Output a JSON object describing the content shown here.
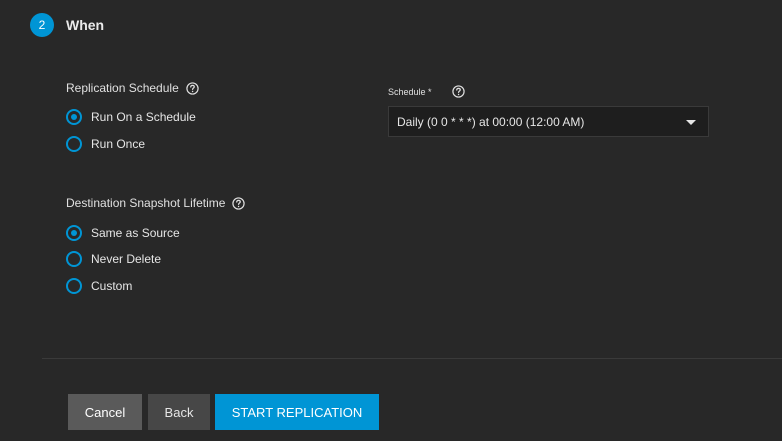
{
  "step": {
    "number": "2",
    "title": "When"
  },
  "replication_schedule": {
    "label": "Replication Schedule",
    "help_icon": "help-circle-icon",
    "options": [
      {
        "label": "Run On a Schedule",
        "selected": true
      },
      {
        "label": "Run Once",
        "selected": false
      }
    ]
  },
  "schedule": {
    "label": "Schedule *",
    "help_icon": "help-circle-icon",
    "value": "Daily (0 0 * * *) at 00:00 (12:00 AM)",
    "dropdown_icon": "caret-down-icon"
  },
  "snapshot_lifetime": {
    "label": "Destination Snapshot Lifetime",
    "help_icon": "help-circle-icon",
    "options": [
      {
        "label": "Same as Source",
        "selected": true
      },
      {
        "label": "Never Delete",
        "selected": false
      },
      {
        "label": "Custom",
        "selected": false
      }
    ]
  },
  "actions": {
    "cancel": "Cancel",
    "back": "Back",
    "start": "START REPLICATION"
  },
  "colors": {
    "accent": "#0095d5",
    "background": "#282828"
  }
}
